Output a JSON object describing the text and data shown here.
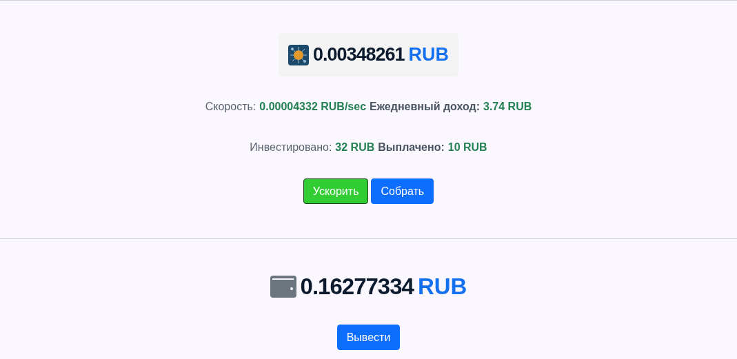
{
  "miner": {
    "amount": "0.00348261",
    "currency": "RUB",
    "stats": [
      [
        {
          "label": "Скорость:",
          "value": "0.00004332 RUB/sec"
        },
        {
          "label": "Ежедневный доход:",
          "value": "3.74 RUB"
        }
      ],
      [
        {
          "label": "Инвестировано:",
          "value": "32 RUB"
        },
        {
          "label": "Выплачено:",
          "value": "10 RUB"
        }
      ]
    ],
    "buttons": [
      {
        "label": "Ускорить",
        "kind": "boost"
      },
      {
        "label": "Собрать",
        "kind": "main"
      }
    ]
  },
  "wallet": {
    "amount": "0.16277334",
    "currency": "RUB",
    "buttons": [
      {
        "label": "Вывести",
        "kind": "main"
      }
    ]
  }
}
